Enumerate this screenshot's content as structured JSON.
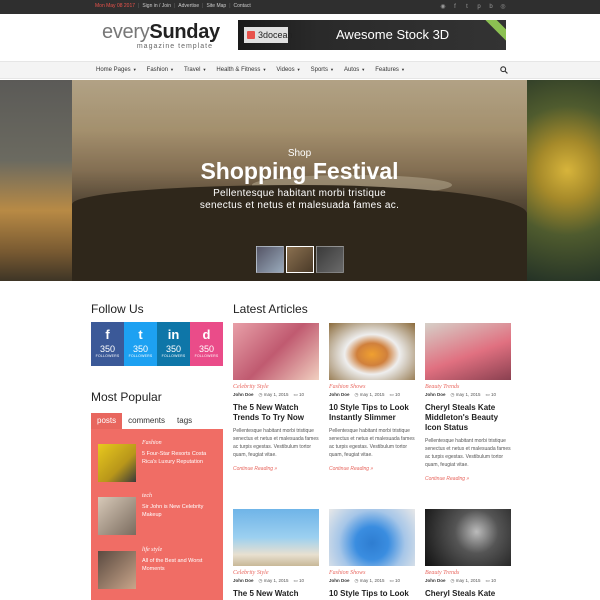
{
  "topbar": {
    "date": "Mon May 08 2017",
    "links": [
      "Sign in / Join",
      "Advertise",
      "Site Map",
      "Contact"
    ],
    "social_icons": [
      "rss-icon",
      "facebook-icon",
      "twitter-icon",
      "pinterest-icon",
      "behance-icon",
      "dribbble-icon"
    ]
  },
  "logo": {
    "light": "every",
    "bold": "Sunday",
    "tagline": "magazine template"
  },
  "banner": {
    "brand": "3docean",
    "text": "Awesome Stock 3D"
  },
  "nav": {
    "items": [
      "Home Pages",
      "Fashion",
      "Travel",
      "Health & Fitness",
      "Videos",
      "Sports",
      "Autos",
      "Features"
    ]
  },
  "hero": {
    "kicker": "Shop",
    "title": "Shopping Festival",
    "subtitle_line1": "Pellentesque habitant morbi tristique",
    "subtitle_line2": "senectus et netus et malesuada fames ac."
  },
  "follow": {
    "title": "Follow Us",
    "items": [
      {
        "icon": "f",
        "count": "350",
        "label": "FOLLOWERS"
      },
      {
        "icon": "t",
        "count": "350",
        "label": "FOLLOWERS"
      },
      {
        "icon": "in",
        "count": "350",
        "label": "FOLLOWERS"
      },
      {
        "icon": "d",
        "count": "350",
        "label": "FOLLOWERS"
      }
    ]
  },
  "popular": {
    "title": "Most Popular",
    "tabs": [
      "posts",
      "comments",
      "tags"
    ],
    "items": [
      {
        "category": "Fashion",
        "title": "5 Four-Star Resorts Costa Rica's Luxury Reputation"
      },
      {
        "category": "tech",
        "title": "Sir John is New Celebrity Makeup"
      },
      {
        "category": "life style",
        "title": "All of the Best and Worst Moments"
      }
    ]
  },
  "latest": {
    "title": "Latest Articles",
    "cards": [
      {
        "category": "Celebrity Style",
        "author": "John Doe",
        "date": "may 1, 2015",
        "comments": "10",
        "title": "The 5 New Watch Trends To Try Now",
        "excerpt": "Pellentesque habitant morbi tristique senectus et netus et malesuada fames ac turpis egestas. Vestibulum tortor quam, feugiat vitae.",
        "more": "Continue Reading »"
      },
      {
        "category": "Fashion Shows",
        "author": "John Doe",
        "date": "may 1, 2015",
        "comments": "10",
        "title": "10 Style Tips to Look Instantly Slimmer",
        "excerpt": "Pellentesque habitant morbi tristique senectus et netus et malesuada fames ac turpis egestas. Vestibulum tortor quam, feugiat vitae.",
        "more": "Continue Reading »"
      },
      {
        "category": "Beauty Trends",
        "author": "John Doe",
        "date": "may 1, 2015",
        "comments": "10",
        "title": "Cheryl Steals Kate Middleton's Beauty Icon Status",
        "excerpt": "Pellentesque habitant morbi tristique senectus et netus et malesuada fames ac turpis egestas. Vestibulum tortor quam, feugiat vitae.",
        "more": "Continue Reading »"
      },
      {
        "category": "Celebrity Style",
        "author": "John Doe",
        "date": "may 1, 2015",
        "comments": "10",
        "title": "The 5 New Watch",
        "excerpt": "",
        "more": ""
      },
      {
        "category": "Fashion Shows",
        "author": "John Doe",
        "date": "may 1, 2015",
        "comments": "10",
        "title": "10 Style Tips to Look",
        "excerpt": "",
        "more": ""
      },
      {
        "category": "Beauty Trends",
        "author": "John Doe",
        "date": "may 1, 2015",
        "comments": "10",
        "title": "Cheryl Steals Kate",
        "excerpt": "",
        "more": ""
      }
    ]
  }
}
